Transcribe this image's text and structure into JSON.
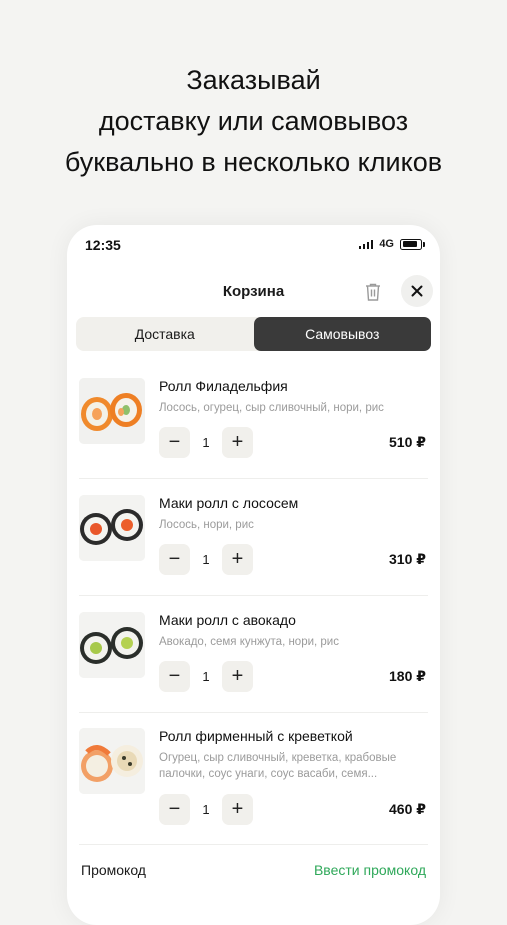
{
  "headline": {
    "line1": "Заказывай",
    "line2": "доставку или самовывоз",
    "line3": "буквально в несколько кликов"
  },
  "status_bar": {
    "time": "12:35",
    "network": "4G"
  },
  "cart": {
    "title": "Корзина",
    "tabs": [
      {
        "label": "Доставка",
        "active": false
      },
      {
        "label": "Самовывоз",
        "active": true
      }
    ],
    "items": [
      {
        "name": "Ролл Филадельфия",
        "description": "Лосось, огурец, сыр сливочный, нори, рис",
        "quantity": "1",
        "price": "510 ₽",
        "minus": "−",
        "plus": "+"
      },
      {
        "name": "Маки ролл с лососем",
        "description": "Лосось, нори, рис",
        "quantity": "1",
        "price": "310 ₽",
        "minus": "−",
        "plus": "+"
      },
      {
        "name": "Маки ролл с авокадо",
        "description": "Авокадо, семя кунжута, нори, рис",
        "quantity": "1",
        "price": "180 ₽",
        "minus": "−",
        "plus": "+"
      },
      {
        "name": "Ролл фирменный с креветкой",
        "description": "Огурец, сыр сливочный, креветка, крабовые палочки, соус унаги, соус васаби, семя...",
        "quantity": "1",
        "price": "460 ₽",
        "minus": "−",
        "plus": "+"
      }
    ],
    "promo": {
      "label": "Промокод",
      "link": "Ввести промокод"
    }
  },
  "colors": {
    "accent_green": "#2fa85a",
    "active_tab": "#3a3a3a",
    "muted_bg": "#f1f0ec"
  },
  "icons": [
    "signal-icon",
    "battery-icon",
    "trash-icon",
    "close-icon"
  ]
}
